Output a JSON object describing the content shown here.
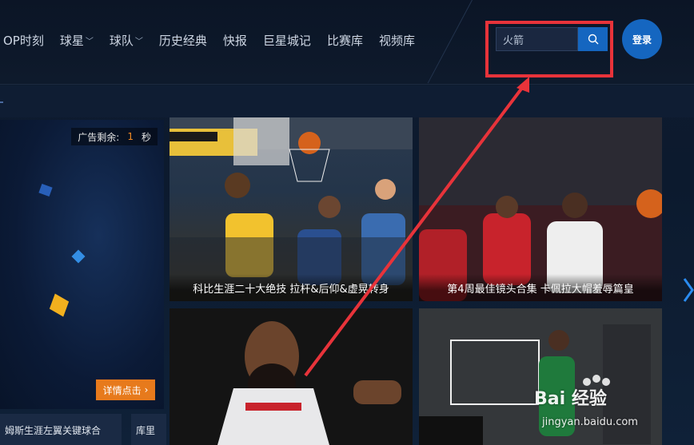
{
  "nav": {
    "items": [
      {
        "label": "OP时刻",
        "dropdown": false
      },
      {
        "label": "球星",
        "dropdown": true
      },
      {
        "label": "球队",
        "dropdown": true
      },
      {
        "label": "历史经典",
        "dropdown": false
      },
      {
        "label": "快报",
        "dropdown": false
      },
      {
        "label": "巨星城记",
        "dropdown": false
      },
      {
        "label": "比赛库",
        "dropdown": false
      },
      {
        "label": "视频库",
        "dropdown": false
      }
    ]
  },
  "search": {
    "value": "火箭",
    "icon": "search-icon"
  },
  "login": {
    "label": "登录"
  },
  "ad": {
    "remaining_label": "广告剩余:",
    "remaining_seconds": "1",
    "seconds_unit": "秒",
    "detail_label": "详情点击"
  },
  "under_items": [
    {
      "text": "姆斯生涯左翼关键球合"
    },
    {
      "text": "库里"
    }
  ],
  "videos": [
    {
      "caption": "科比生涯二十大绝技 拉杆&后仰&虚晃转身"
    },
    {
      "caption": "第4周最佳镜头合集 卡佩拉大帽羞辱篇皇"
    },
    {
      "caption": ""
    },
    {
      "caption": ""
    }
  ],
  "watermark": {
    "brand": "Bai 经验",
    "url": "jingyan.baidu.com"
  },
  "colors": {
    "accent": "#1566c0",
    "highlight": "#e8333a",
    "ad_orange": "#e77a1c"
  }
}
